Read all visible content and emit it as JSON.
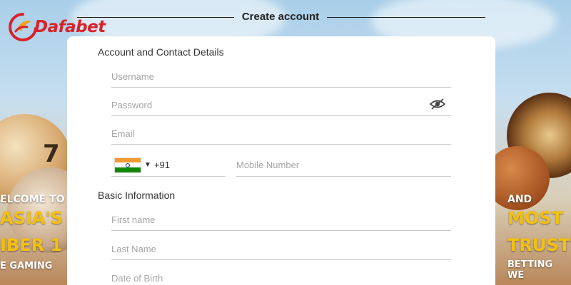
{
  "brand": {
    "name": "Dafabet",
    "color": "#d8232a"
  },
  "page": {
    "title": "Create account"
  },
  "form": {
    "sections": {
      "account": "Account and Contact Details",
      "basic": "Basic Information"
    },
    "fields": {
      "username": {
        "placeholder": "Username",
        "value": ""
      },
      "password": {
        "placeholder": "Password",
        "value": ""
      },
      "email": {
        "placeholder": "Email",
        "value": ""
      },
      "country_code": "+91",
      "mobile": {
        "placeholder": "Mobile Number",
        "value": ""
      },
      "first_name": {
        "placeholder": "First name",
        "value": ""
      },
      "last_name": {
        "placeholder": "Last Name",
        "value": ""
      },
      "dob": {
        "placeholder": "Date of Birth",
        "value": ""
      }
    },
    "icons": {
      "password_toggle": "eye-slash-icon",
      "flag": "india-flag-icon",
      "caret": "caret-down-icon"
    }
  },
  "background": {
    "ball_number": "7",
    "left_promo": [
      "ELCOME TO",
      "ASIA'S",
      "IBER 1",
      "E GAMING"
    ],
    "right_promo": [
      "AND",
      "MOST",
      "TRUST",
      "BETTING WE"
    ]
  },
  "colors": {
    "accent_yellow": "#f2c10f",
    "card": "#ffffff"
  }
}
